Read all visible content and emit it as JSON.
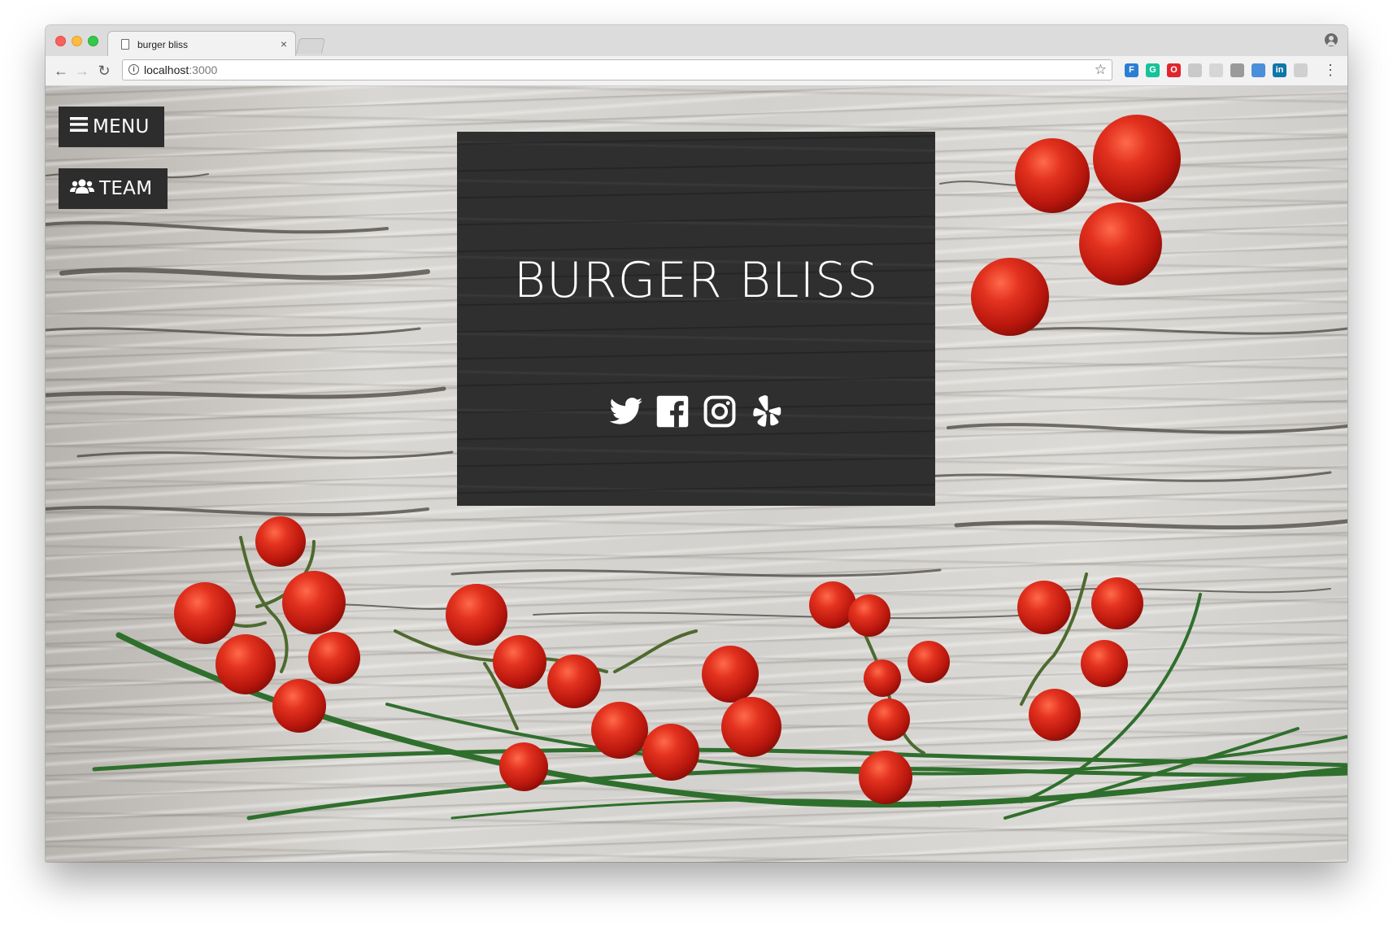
{
  "browser": {
    "tab_title": "burger bliss",
    "tab_close": "×",
    "url_host": "localhost",
    "url_port": ":3000",
    "back_glyph": "←",
    "forward_glyph": "→",
    "reload_glyph": "↻",
    "star_glyph": "☆",
    "menu_glyph": "⋮",
    "info_glyph": "i",
    "extensions": [
      {
        "name": "feedly-ext-icon",
        "color": "#2a7fd4",
        "glyph": "F"
      },
      {
        "name": "grammarly-ext-icon",
        "color": "#15c39a",
        "glyph": "G"
      },
      {
        "name": "opera-ext-icon",
        "color": "#e0262d",
        "glyph": "O"
      },
      {
        "name": "circle-ext-icon",
        "color": "#c9c9c9",
        "glyph": ""
      },
      {
        "name": "shield-ext-icon",
        "color": "#d6d6d6",
        "glyph": ""
      },
      {
        "name": "stamp-ext-icon",
        "color": "#9a9a9a",
        "glyph": ""
      },
      {
        "name": "window-ext-icon",
        "color": "#4a8fd9",
        "glyph": ""
      },
      {
        "name": "linkedin-ext-icon",
        "color": "#0e76a8",
        "glyph": "in"
      },
      {
        "name": "grid-ext-icon",
        "color": "#d0d0d0",
        "glyph": ""
      }
    ]
  },
  "page": {
    "menu_label": "MENU",
    "team_label": "TEAM",
    "title": "BURGER BLISS",
    "social_icons": [
      "twitter-icon",
      "facebook-icon",
      "instagram-icon",
      "yelp-icon"
    ]
  },
  "colors": {
    "panel": "#2f2f2f",
    "button": "#2d2d2d",
    "tomato": "#d92a1c",
    "chive": "#2f6f2d"
  }
}
